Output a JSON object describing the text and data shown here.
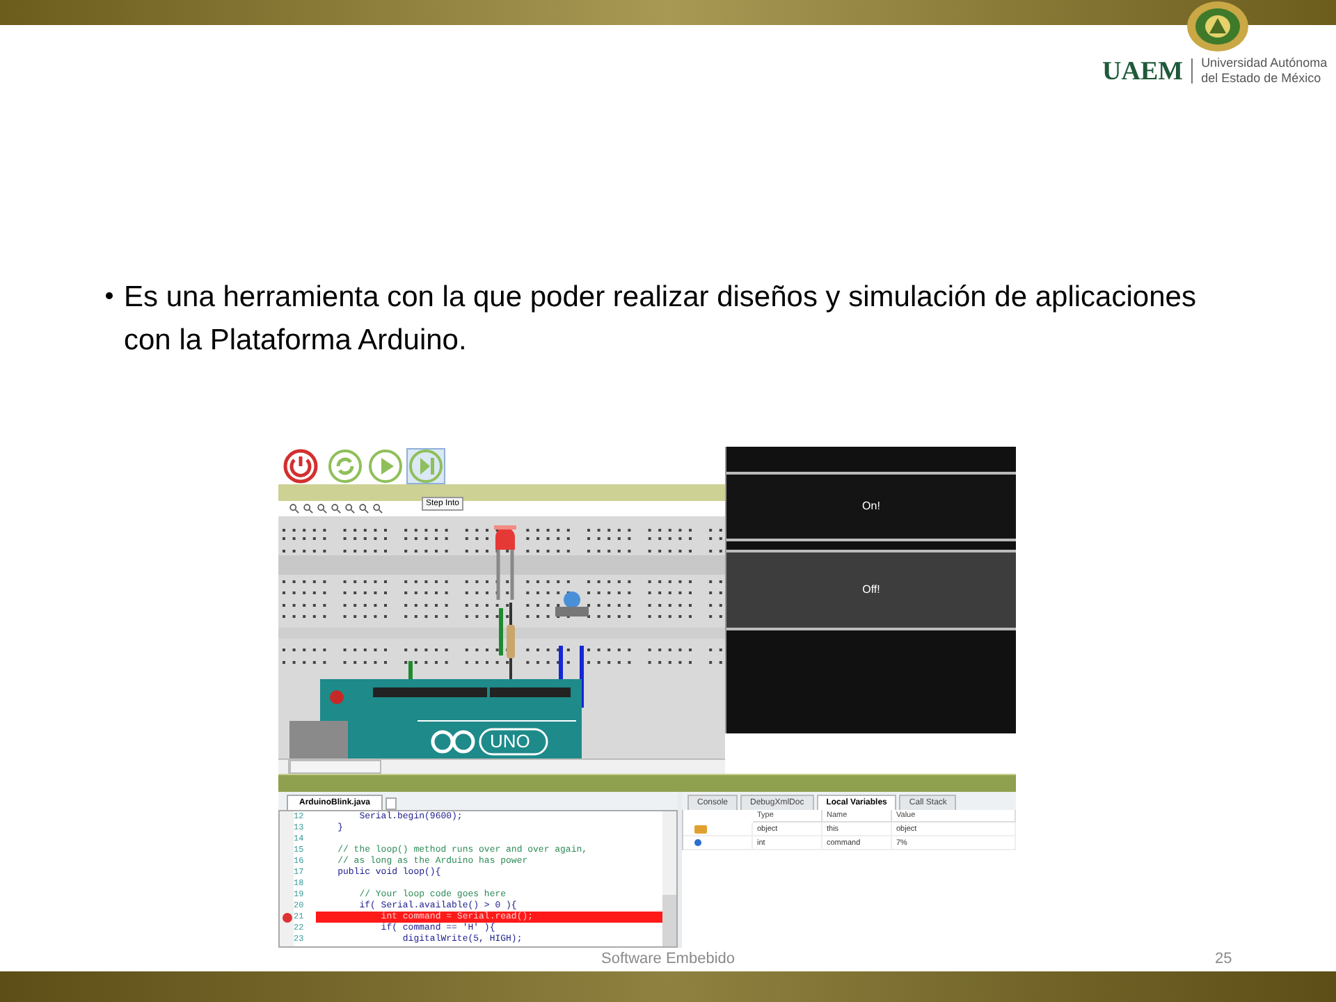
{
  "logo": {
    "acronym": "UAEM",
    "name_lines": [
      "Universidad Autónoma",
      "del Estado de México"
    ]
  },
  "bullet": "Es una herramienta con la que poder realizar diseños y simulación de aplicaciones con la Plataforma Arduino.",
  "simulator": {
    "toolbar": [
      {
        "kind": "power",
        "highlighted": false
      },
      {
        "kind": "reset",
        "highlighted": false
      },
      {
        "kind": "run",
        "highlighted": false
      },
      {
        "kind": "step",
        "highlighted": true
      }
    ],
    "tooltip": "Step Into",
    "board_label": "UNO",
    "panel_buttons": [
      {
        "label": "On!",
        "hovered": false
      },
      {
        "label": "Off!",
        "hovered": true
      }
    ],
    "editor": {
      "tab": "ArduinoBlink.java",
      "lines": [
        {
          "number": "12",
          "text": "        Serial.begin(9600);",
          "kind": "code",
          "breakpoint": false
        },
        {
          "number": "13",
          "text": "    }",
          "kind": "code",
          "breakpoint": false
        },
        {
          "number": "14",
          "kind": "code",
          "breakpoint": false
        },
        {
          "number": "15",
          "text": "    // the loop() method runs over and over again,",
          "kind": "comment",
          "breakpoint": false
        },
        {
          "number": "16",
          "text": "    // as long as the Arduino has power",
          "kind": "comment",
          "breakpoint": false
        },
        {
          "number": "17",
          "text": "    public void loop(){",
          "kind": "code",
          "breakpoint": false
        },
        {
          "number": "18",
          "kind": "code",
          "breakpoint": false
        },
        {
          "number": "19",
          "text": "        // Your loop code goes here",
          "kind": "comment",
          "breakpoint": false
        },
        {
          "number": "20",
          "text": "        if( Serial.available() > 0 ){",
          "kind": "code",
          "breakpoint": false
        },
        {
          "number": "21",
          "text": "            int command = Serial.read();",
          "kind": "code",
          "breakpoint": true
        },
        {
          "number": "22",
          "text": "            if( command == 'H' ){",
          "kind": "code",
          "breakpoint": false
        },
        {
          "number": "23",
          "text": "                digitalWrite(5, HIGH);",
          "kind": "code",
          "breakpoint": false
        }
      ]
    },
    "debug": {
      "tabs": [
        {
          "label": "Console",
          "selected": false
        },
        {
          "label": "DebugXmlDoc",
          "selected": false
        },
        {
          "label": "Local Variables",
          "selected": true
        },
        {
          "label": "Call Stack",
          "selected": false
        }
      ],
      "columns": [
        "Type",
        "Name",
        "Value"
      ],
      "rows": [
        {
          "kind": "object",
          "type": "object",
          "name": "this",
          "value": "object"
        },
        {
          "kind": "variable",
          "type": "int",
          "name": "command",
          "value": "7%"
        }
      ]
    }
  },
  "footer": "Software Embebido",
  "page_number": "25"
}
